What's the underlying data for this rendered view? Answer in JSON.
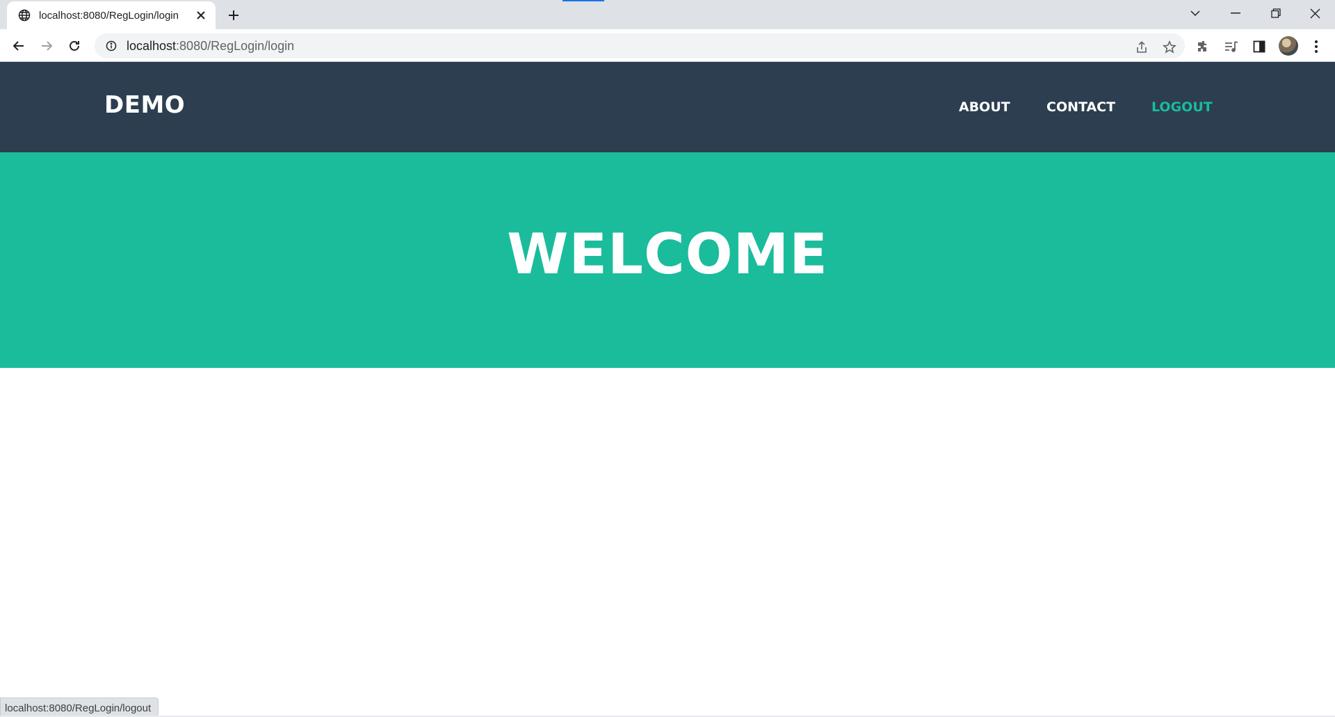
{
  "browser": {
    "tab_title": "localhost:8080/RegLogin/login",
    "url_host": "localhost",
    "url_path": ":8080/RegLogin/login",
    "status_url": "localhost:8080/RegLogin/logout",
    "icons": [
      "globe-icon",
      "close-icon",
      "plus-icon",
      "chevron-down-icon",
      "minimize-icon",
      "restore-icon",
      "window-close-icon",
      "back-arrow-icon",
      "forward-arrow-icon",
      "reload-icon",
      "info-icon",
      "share-icon",
      "star-icon",
      "extensions-icon",
      "media-icon",
      "side-panel-icon",
      "menu-dots-icon"
    ]
  },
  "site": {
    "brand": "DEMO",
    "nav": [
      {
        "label": "ABOUT"
      },
      {
        "label": "CONTACT"
      },
      {
        "label": "LOGOUT",
        "active": true
      }
    ],
    "hero_title": "WELCOME"
  },
  "colors": {
    "navbar": "#2c3e50",
    "accent": "#1abc9c",
    "white": "#ffffff"
  }
}
